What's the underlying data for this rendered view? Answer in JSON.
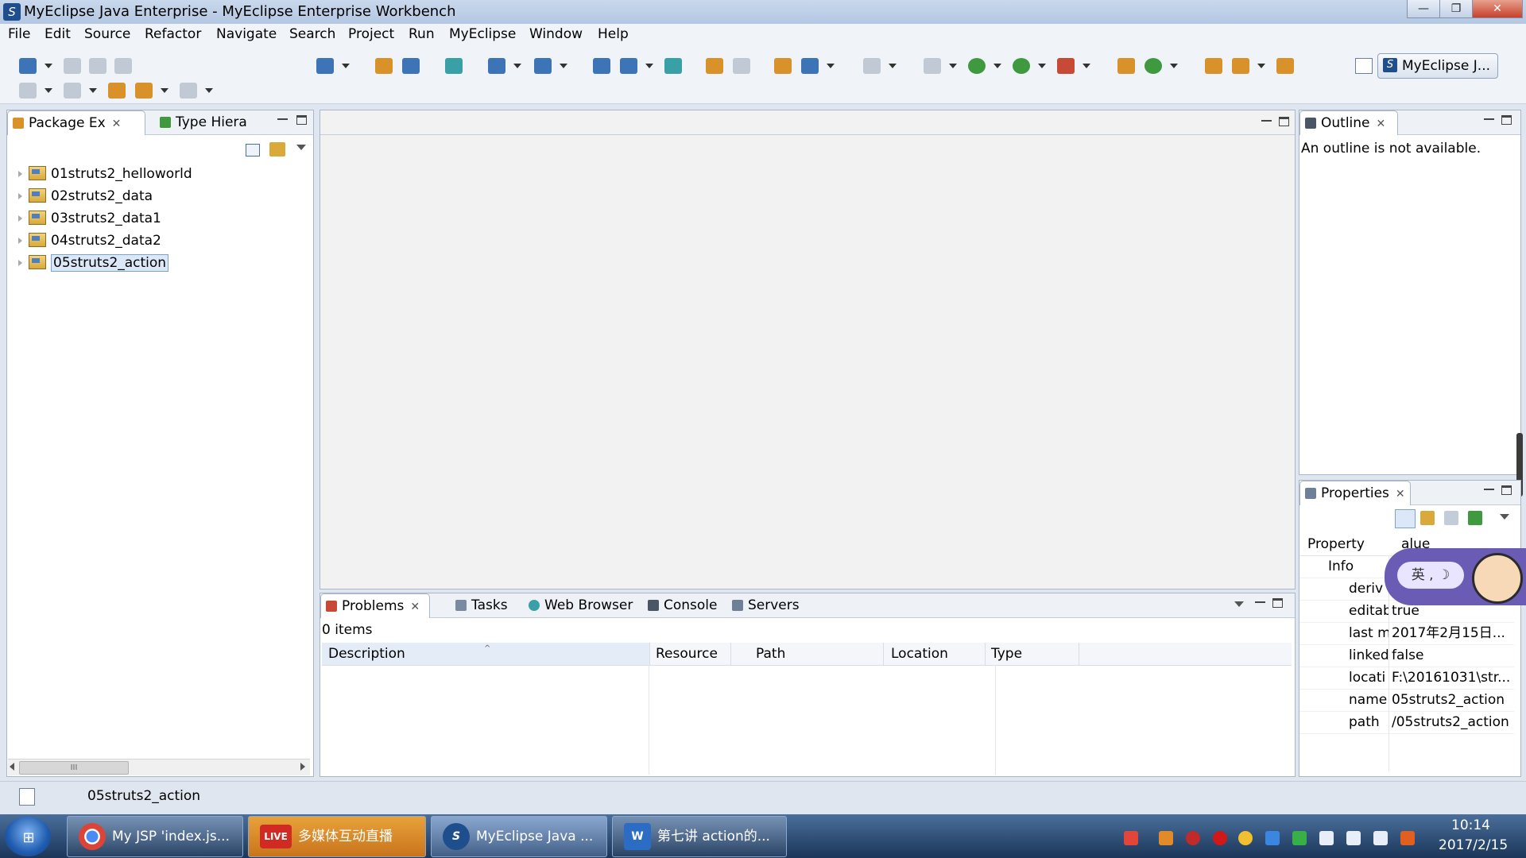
{
  "window": {
    "title": "MyEclipse Java Enterprise - MyEclipse Enterprise Workbench",
    "min_glyph": "—",
    "max_glyph": "❐",
    "close_glyph": "✕"
  },
  "menu": [
    "File",
    "Edit",
    "Source",
    "Refactor",
    "Navigate",
    "Search",
    "Project",
    "Run",
    "MyEclipse",
    "Window",
    "Help"
  ],
  "perspective": {
    "label": "MyEclipse J..."
  },
  "package_explorer": {
    "tabs": [
      {
        "label": "Package Ex",
        "active": true
      },
      {
        "label": "Type Hiera",
        "active": false
      }
    ],
    "projects": [
      "01struts2_helloworld",
      "02struts2_data",
      "03struts2_data1",
      "04struts2_data2",
      "05struts2_action"
    ],
    "selected": "05struts2_action",
    "scroll_thumb": "III"
  },
  "outline": {
    "tab_label": "Outline",
    "message": "An outline is not available."
  },
  "bottom_panel": {
    "tabs": [
      {
        "label": "Problems",
        "active": true
      },
      {
        "label": "Tasks"
      },
      {
        "label": "Web Browser"
      },
      {
        "label": "Console"
      },
      {
        "label": "Servers"
      }
    ],
    "count": "0 items",
    "columns": [
      "Description",
      "Resource",
      "Path",
      "Location",
      "Type"
    ]
  },
  "properties": {
    "tab_label": "Properties",
    "columns": [
      "Property",
      "alue"
    ],
    "group": "Info",
    "rows": [
      {
        "key": "deriv",
        "value": ""
      },
      {
        "key": "editab",
        "value": "true"
      },
      {
        "key": "last m",
        "value": "2017年2月15日..."
      },
      {
        "key": "linked",
        "value": "false"
      },
      {
        "key": "locati",
        "value": "F:\\20161031\\str..."
      },
      {
        "key": "name",
        "value": "05struts2_action"
      },
      {
        "key": "path",
        "value": "/05struts2_action"
      }
    ]
  },
  "status": {
    "selection": "05struts2_action"
  },
  "ime": {
    "label": "英 ,  ☽"
  },
  "taskbar": {
    "start_glyph": "⊞",
    "tasks": [
      {
        "label": "My JSP 'index.js...",
        "icon": "chrome-icon",
        "icon_text": "",
        "active": false
      },
      {
        "label": "多媒体互动直播",
        "icon": "live-icon",
        "icon_text": "LIVE",
        "active": false
      },
      {
        "label": "MyEclipse Java ...",
        "icon": "myeclipse-icon",
        "icon_text": "S",
        "active": true
      },
      {
        "label": "第七讲 action的...",
        "icon": "word-icon",
        "icon_text": "W",
        "active": false
      }
    ],
    "time": "10:14",
    "date": "2017/2/15"
  },
  "colors": {
    "accent": "#3d74b8",
    "panel_border": "#a9b7c9",
    "selection": "#dbe8f8",
    "taskbar": "#1b3659"
  }
}
